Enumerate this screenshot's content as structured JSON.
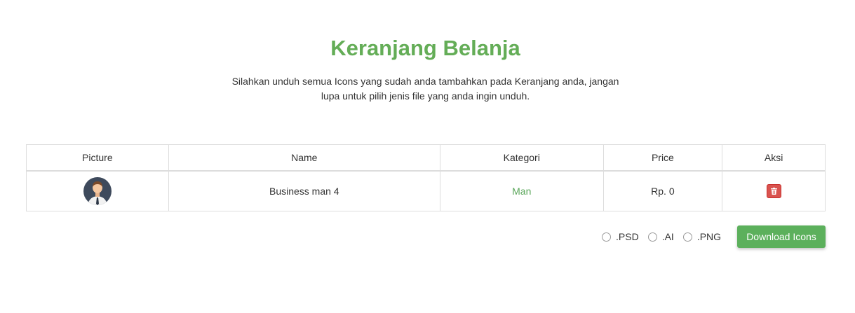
{
  "header": {
    "title": "Keranjang Belanja",
    "subtitle": "Silahkan unduh semua Icons yang sudah anda tambahkan pada Keranjang anda, jangan lupa untuk pilih jenis file yang anda ingin unduh."
  },
  "table": {
    "columns": [
      "Picture",
      "Name",
      "Kategori",
      "Price",
      "Aksi"
    ],
    "rows": [
      {
        "picture_icon": "businessman-avatar-icon",
        "name": "Business man 4",
        "kategori": "Man",
        "price": "Rp. 0",
        "aksi_icon": "trash-icon"
      }
    ]
  },
  "file_types": {
    "options": [
      ".PSD",
      ".AI",
      ".PNG"
    ]
  },
  "download_button": {
    "label": "Download Icons"
  },
  "colors": {
    "accent_green": "#64ad57",
    "button_green": "#5cb05c",
    "danger_red": "#d9534f"
  }
}
